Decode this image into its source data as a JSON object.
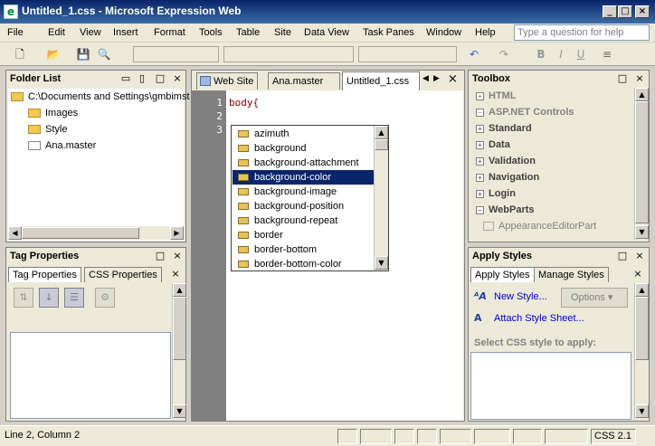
{
  "window": {
    "title": "Untitled_1.css - Microsoft Expression Web",
    "minimize": "_",
    "maximize": "□",
    "close": "×"
  },
  "menu": [
    "File",
    "Edit",
    "View",
    "Insert",
    "Format",
    "Tools",
    "Table",
    "Site",
    "Data View",
    "Task Panes",
    "Window",
    "Help"
  ],
  "help_placeholder": "Type a question for help",
  "folder_list": {
    "title": "Folder List",
    "root": "C:\\Documents and Settings\\gmbimst",
    "items": [
      "Images",
      "Style",
      "Ana.master"
    ]
  },
  "tag_properties": {
    "title": "Tag Properties",
    "tabs": [
      "Tag Properties",
      "CSS Properties"
    ]
  },
  "editor": {
    "tabs": [
      "Web Site",
      "Ana.master",
      "Untitled_1.css"
    ],
    "line_numbers": [
      "1",
      "2",
      "3"
    ],
    "code_line1": "body{",
    "intellisense": [
      "azimuth",
      "background",
      "background-attachment",
      "background-color",
      "background-image",
      "background-position",
      "background-repeat",
      "border",
      "border-bottom",
      "border-bottom-color"
    ],
    "selected_index": 3
  },
  "toolbox": {
    "title": "Toolbox",
    "categories": [
      {
        "label": "HTML",
        "sign": "+",
        "gray": true
      },
      {
        "label": "ASP.NET Controls",
        "sign": "−",
        "gray": true
      },
      {
        "label": "Standard",
        "sign": "+",
        "gray": false
      },
      {
        "label": "Data",
        "sign": "+",
        "gray": false
      },
      {
        "label": "Validation",
        "sign": "+",
        "gray": false
      },
      {
        "label": "Navigation",
        "sign": "+",
        "gray": false
      },
      {
        "label": "Login",
        "sign": "+",
        "gray": false
      },
      {
        "label": "WebParts",
        "sign": "−",
        "gray": false
      }
    ],
    "sub_item": "AppearanceEditorPart"
  },
  "apply_styles": {
    "title": "Apply Styles",
    "tabs": [
      "Apply Styles",
      "Manage Styles"
    ],
    "new_style": "New Style...",
    "options": "Options",
    "attach": "Attach Style Sheet...",
    "select_label": "Select CSS style to apply:"
  },
  "status": {
    "position": "Line 2, Column 2",
    "css_version": "CSS 2.1"
  }
}
